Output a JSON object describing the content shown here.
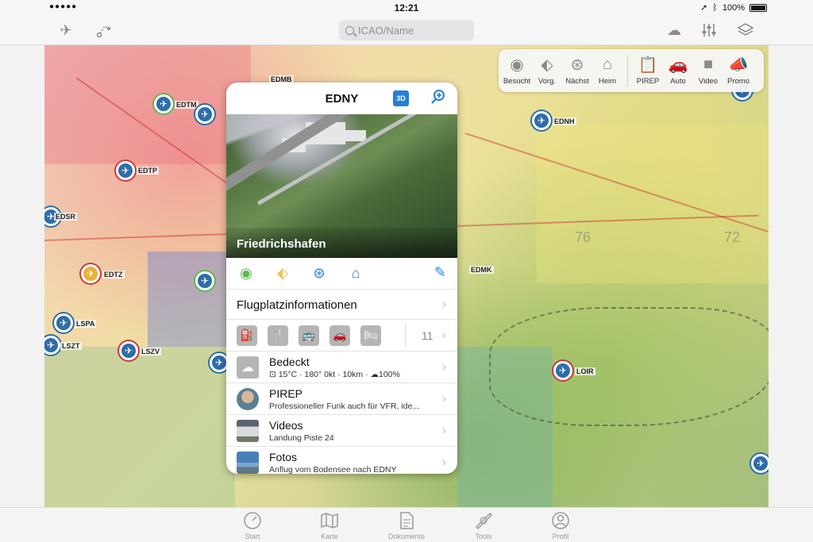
{
  "status_bar": {
    "carrier": "●●●●●",
    "wifi": "wifi",
    "time": "12:21",
    "location_icon": "location-arrow-icon",
    "bluetooth_icon": "bluetooth-icon",
    "battery": "100%"
  },
  "toolbar": {
    "search_placeholder": "ICAO/Name",
    "left_icons": [
      "airplane-icon",
      "route-icon"
    ],
    "right_icons": [
      "weather-cloud-icon",
      "sliders-icon",
      "layers-icon"
    ]
  },
  "quick_panel": {
    "items": [
      {
        "label": "Besucht",
        "icon": "eye-icon"
      },
      {
        "label": "Vorg.",
        "icon": "tag-icon"
      },
      {
        "label": "Nächst",
        "icon": "navigate-pin-icon"
      },
      {
        "label": "Heim",
        "icon": "hangar-icon"
      }
    ],
    "items2": [
      {
        "label": "PIREP",
        "icon": "clipboard-icon"
      },
      {
        "label": "Auto",
        "icon": "car-icon"
      },
      {
        "label": "Video",
        "icon": "video-camera-icon"
      },
      {
        "label": "Promo",
        "icon": "megaphone-icon"
      }
    ]
  },
  "map": {
    "airports": [
      "EDTM",
      "EDTP",
      "EDSR",
      "EDTZ",
      "LSPA",
      "LSZT",
      "LSZV",
      "EDMK",
      "EDNH",
      "LOIR",
      "EDMB"
    ],
    "sector_numbers": [
      "76",
      "72"
    ]
  },
  "popup": {
    "icao": "EDNY",
    "button_3d": "3D",
    "photo_caption": "Friedrichshafen",
    "info_row": "Flugplatzinformationen",
    "services_count": "11",
    "weather": {
      "title": "Bedeckt",
      "details": "⊡ 15°C · 180° 0kt · 10km · ☁100%"
    },
    "pirep": {
      "title": "PIREP",
      "subtitle": "Professioneller Funk auch für VFR, ide..."
    },
    "videos": {
      "title": "Videos",
      "subtitle": "Landung Piste 24"
    },
    "fotos": {
      "title": "Fotos",
      "subtitle": "Anflug vom Bodensee nach EDNY"
    },
    "colors": {
      "visited": "#5fb84a",
      "favorite": "#f2c14e",
      "navigate": "#2580d8",
      "home": "#2580d8"
    }
  },
  "tabbar": {
    "tabs": [
      {
        "label": "Start",
        "icon": "gauge-icon"
      },
      {
        "label": "Karte",
        "icon": "map-icon"
      },
      {
        "label": "Dokumente",
        "icon": "document-icon"
      },
      {
        "label": "Tools",
        "icon": "protractor-icon"
      },
      {
        "label": "Profil",
        "icon": "person-icon"
      }
    ]
  }
}
